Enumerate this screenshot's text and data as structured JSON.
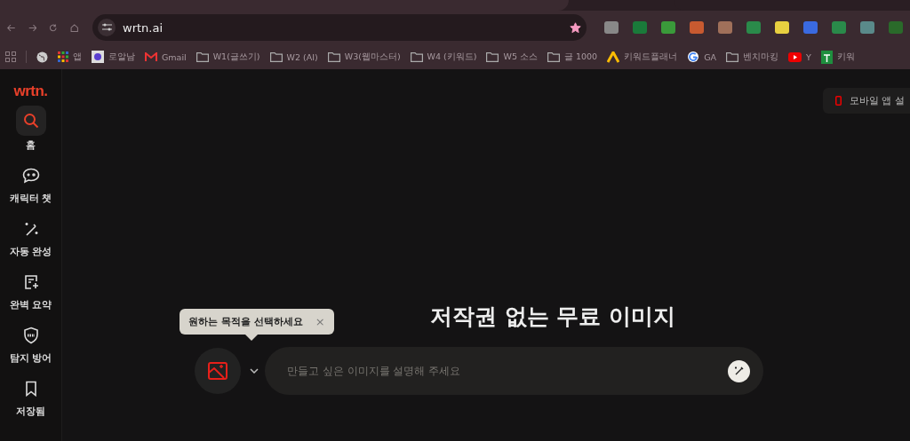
{
  "browser": {
    "url": "wrtn.ai",
    "bookmarked": true,
    "bookmarks": [
      {
        "label": "앱",
        "kind": "apps"
      },
      {
        "label": "로알남",
        "kind": "site"
      },
      {
        "label": "Gmail",
        "kind": "gmail"
      },
      {
        "label": "W1(글쓰기)",
        "kind": "folder"
      },
      {
        "label": "W2 (AI)",
        "kind": "folder"
      },
      {
        "label": "W3(웹마스터)",
        "kind": "folder"
      },
      {
        "label": "W4 (키워드)",
        "kind": "folder"
      },
      {
        "label": "W5 소스",
        "kind": "folder"
      },
      {
        "label": "글 1000",
        "kind": "folder"
      },
      {
        "label": "키워드플래너",
        "kind": "ads"
      },
      {
        "label": "GA",
        "kind": "google"
      },
      {
        "label": "벤치마킹",
        "kind": "folder"
      },
      {
        "label": "Y",
        "kind": "youtube"
      },
      {
        "label": "키워",
        "kind": "sheet"
      }
    ]
  },
  "app": {
    "logo": "wrtn.",
    "sidebar": [
      {
        "label": "홈",
        "kind": "search",
        "selected": true
      },
      {
        "label": "캐릭터 챗",
        "kind": "chat",
        "selected": false
      },
      {
        "label": "자동 완성",
        "kind": "wand",
        "selected": false
      },
      {
        "label": "완벽 요약",
        "kind": "doc",
        "selected": false
      },
      {
        "label": "탐지 방어",
        "kind": "shield",
        "selected": false
      },
      {
        "label": "저장됨",
        "kind": "bookmark",
        "selected": false
      }
    ],
    "mobile_button": "모바일 앱 설",
    "heading": "저작권 없는 무료 이미지",
    "tooltip": "원하는 목적을 선택하세요",
    "tooltip_close": "×",
    "prompt": {
      "placeholder": "만들고 싶은 이미지를 설명해 주세요"
    }
  }
}
